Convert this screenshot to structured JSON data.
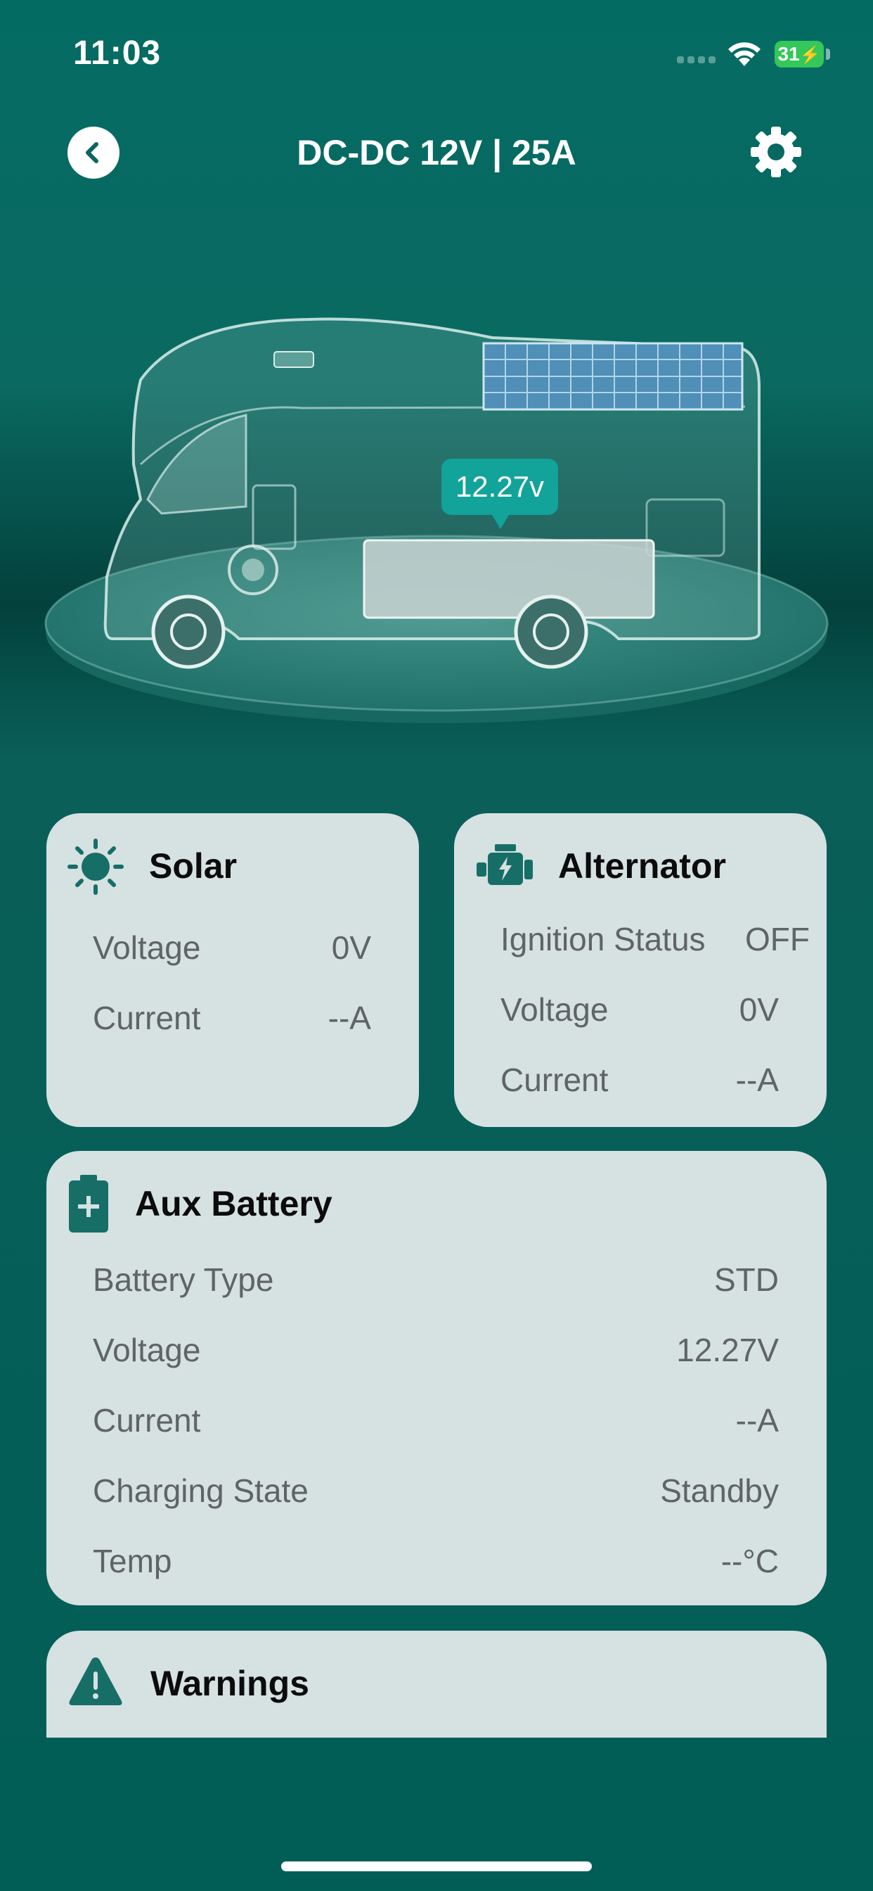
{
  "status_bar": {
    "time": "11:03",
    "battery_level": "31"
  },
  "header": {
    "title": "DC-DC 12V | 25A"
  },
  "vehicle": {
    "voltage_tag": "12.27v"
  },
  "solar": {
    "title": "Solar",
    "rows": [
      {
        "label": "Voltage",
        "value": "0V"
      },
      {
        "label": "Current",
        "value": "--A"
      }
    ]
  },
  "alternator": {
    "title": "Alternator",
    "rows": [
      {
        "label": "Ignition Status",
        "value": "OFF"
      },
      {
        "label": "Voltage",
        "value": "0V"
      },
      {
        "label": "Current",
        "value": "--A"
      }
    ]
  },
  "aux_battery": {
    "title": "Aux Battery",
    "rows": [
      {
        "label": "Battery Type",
        "value": "STD"
      },
      {
        "label": "Voltage",
        "value": "12.27V"
      },
      {
        "label": "Current",
        "value": "--A"
      },
      {
        "label": "Charging State",
        "value": "Standby"
      },
      {
        "label": "Temp",
        "value": "--°C"
      }
    ]
  },
  "warnings": {
    "title": "Warnings"
  },
  "colors": {
    "accent": "#12a39a",
    "icon": "#176e67",
    "card_bg": "#d6e1e1",
    "background": "#005e57",
    "battery_green": "#34c759"
  }
}
